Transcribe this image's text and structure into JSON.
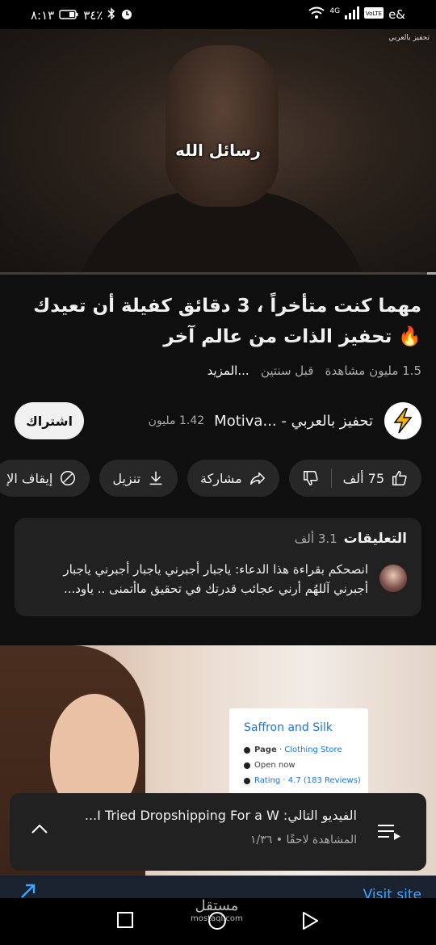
{
  "status_bar": {
    "time": "٨:١٣",
    "battery": "٣٤٪",
    "carrier": "e&",
    "network": "4G"
  },
  "video": {
    "caption": "رسائل الله",
    "channel_watermark": "تحفيز بالعربي",
    "progress_fraction": 0.02
  },
  "title": "مهما كنت متأخراً ، 3 دقائق كفيلة أن تعيدك 🔥 تحفيز الذات من عالم آخر",
  "meta": {
    "views": "1.5 مليون مشاهدة",
    "age": "قبل سنتين",
    "more": "...المزيد"
  },
  "channel": {
    "name": "تحفيز بالعربي - ...Motiva",
    "subscribers": "1.42 مليون",
    "subscribe_label": "اشتراك"
  },
  "actions": {
    "likes": "75 ألف",
    "share": "مشاركة",
    "download": "تنزيل",
    "pause": "إيقاف الإ"
  },
  "comments": {
    "label": "التعليقات",
    "count": "3.1 ألف",
    "top_comment": "انصحكم بقراءة هذا الدعاء: ياجبار أجبرني ياجبار أجبرني ياجبار أجبرني آللهُم أرني عجائب قدرتك في تحقيق ماأتمنى .. ياود..."
  },
  "ad": {
    "business_name": "Saffron and Silk",
    "page_prefix": "Page",
    "page_type": "Clothing Store",
    "open_status": "Open now",
    "rating": "Rating · 4.7 (183 Reviews)",
    "visit_label": "Visit site"
  },
  "up_next": {
    "label": "الفيديو التالي:",
    "title": "I Tried Dropshipping For a W...",
    "subtitle": "المشاهدة لاحقًا",
    "position": "١/٣٦"
  },
  "watermark": {
    "text": "مستقل",
    "sub": "mostaql.com"
  },
  "colors": {
    "background": "#0f0f0f",
    "surface": "#272727",
    "accent_link": "#3ea6ff",
    "channel_icon": "#f5b400"
  }
}
